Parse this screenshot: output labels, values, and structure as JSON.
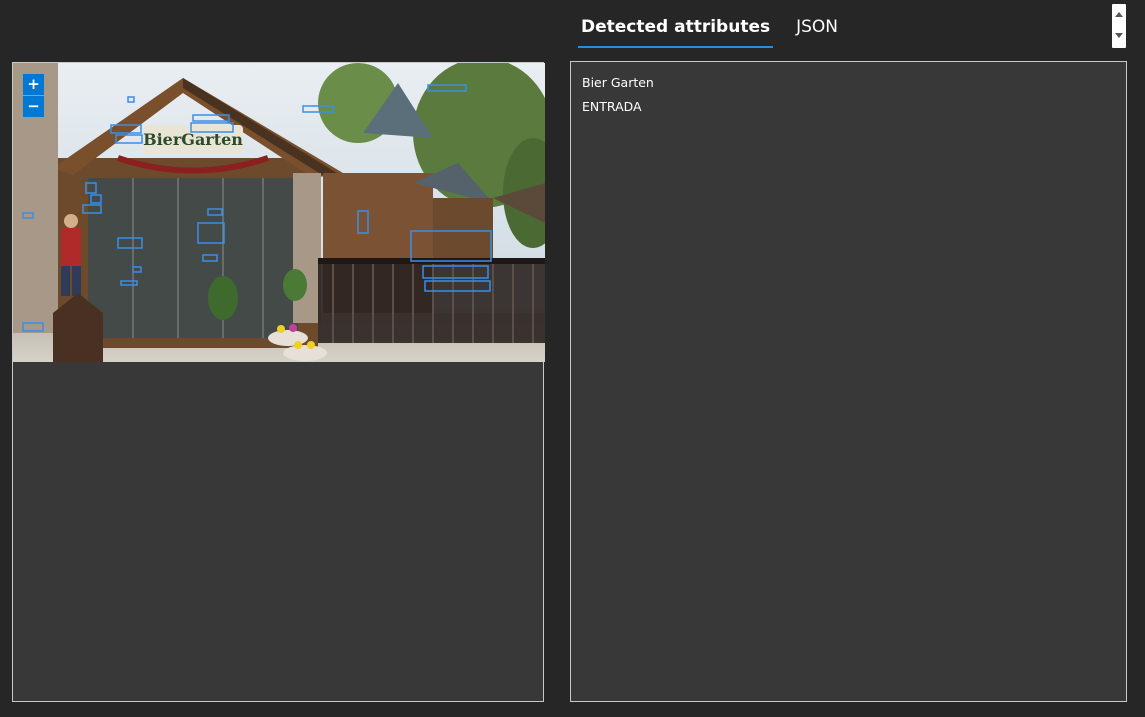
{
  "tabs": [
    {
      "label": "Detected attributes",
      "active": true
    },
    {
      "label": "JSON",
      "active": false
    }
  ],
  "zoom": {
    "in_label": "+",
    "out_label": "−"
  },
  "image": {
    "sign_text": "BierGarten"
  },
  "attributes": [
    "Bier Garten",
    "ENTRADA"
  ],
  "colors": {
    "accent": "#1f8fe6",
    "box": "#3b8ee6",
    "panel": "#383838",
    "background": "#262626"
  }
}
